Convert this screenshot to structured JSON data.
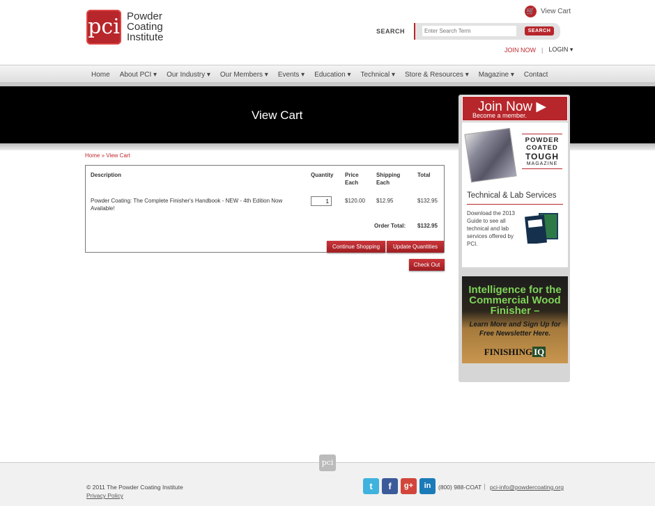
{
  "header": {
    "logo_mark": "pci",
    "logo_lines": [
      "Powder",
      "Coating",
      "Institute"
    ],
    "cart_link": "View Cart",
    "search_label": "SEARCH",
    "search_placeholder": "Enter Search Term",
    "search_button": "SEARCH",
    "join_link": "JOIN NOW",
    "separator": "|",
    "login_link": "LOGIN ▾"
  },
  "nav": {
    "items": [
      "Home",
      "About PCI ▾",
      "Our Industry ▾",
      "Our Members ▾",
      "Events ▾",
      "Education ▾",
      "Technical ▾",
      "Store & Resources ▾",
      "Magazine ▾",
      "Contact"
    ]
  },
  "banner": {
    "title": "View Cart"
  },
  "breadcrumb": {
    "home": "Home",
    "current": "» View Cart"
  },
  "cart": {
    "headers": {
      "description": "Description",
      "quantity": "Quantity",
      "price_1": "Price",
      "price_2": "Each",
      "shipping_1": "Shipping",
      "shipping_2": "Each",
      "total": "Total"
    },
    "row": {
      "description_1": "Powder Coating: The Complete Finisher's Handbook - NEW - 4th Edition Now",
      "description_2": "Available!",
      "quantity": "1",
      "price": "$120.00",
      "shipping": "$12.95",
      "total": "$132.95"
    },
    "order_total_label": "Order Total:",
    "order_total_value": "$132.95",
    "continue_button": "Continue Shopping",
    "update_button": "Update Quantities",
    "checkout_button": "Check Out"
  },
  "sidebar": {
    "join_title": "Join Now ▶",
    "join_sub": "Become a member.",
    "mag_lines": [
      "POWDER",
      "COATED",
      "TOUGH",
      "MAGAZINE"
    ],
    "tech_title": "Technical & Lab Services",
    "tech_text": "Download the 2013 Guide to see all technical and lab services offered by PCI.",
    "ad_line1": "Intelligence for the Commercial Wood Finisher –",
    "ad_line2": "Learn More and Sign Up for Free Newsletter Here.",
    "ad_logo_a": "FINISHING",
    "ad_logo_b": "IQ"
  },
  "footer": {
    "logo": "pci",
    "copyright": "© 2011 The Powder Coating Institute",
    "privacy": "Privacy Policy",
    "phone": "(800) 988-COAT",
    "separator": "|",
    "email": "pci-info@powdercoating.org",
    "social": {
      "twitter": "t",
      "facebook": "f",
      "google": "g+",
      "linkedin": "in"
    }
  },
  "colors": {
    "brand_red": "#b7262b",
    "twitter": "#3fb3dd",
    "facebook": "#3b5a9a",
    "google": "#d2453a",
    "linkedin": "#1b7bb8"
  }
}
